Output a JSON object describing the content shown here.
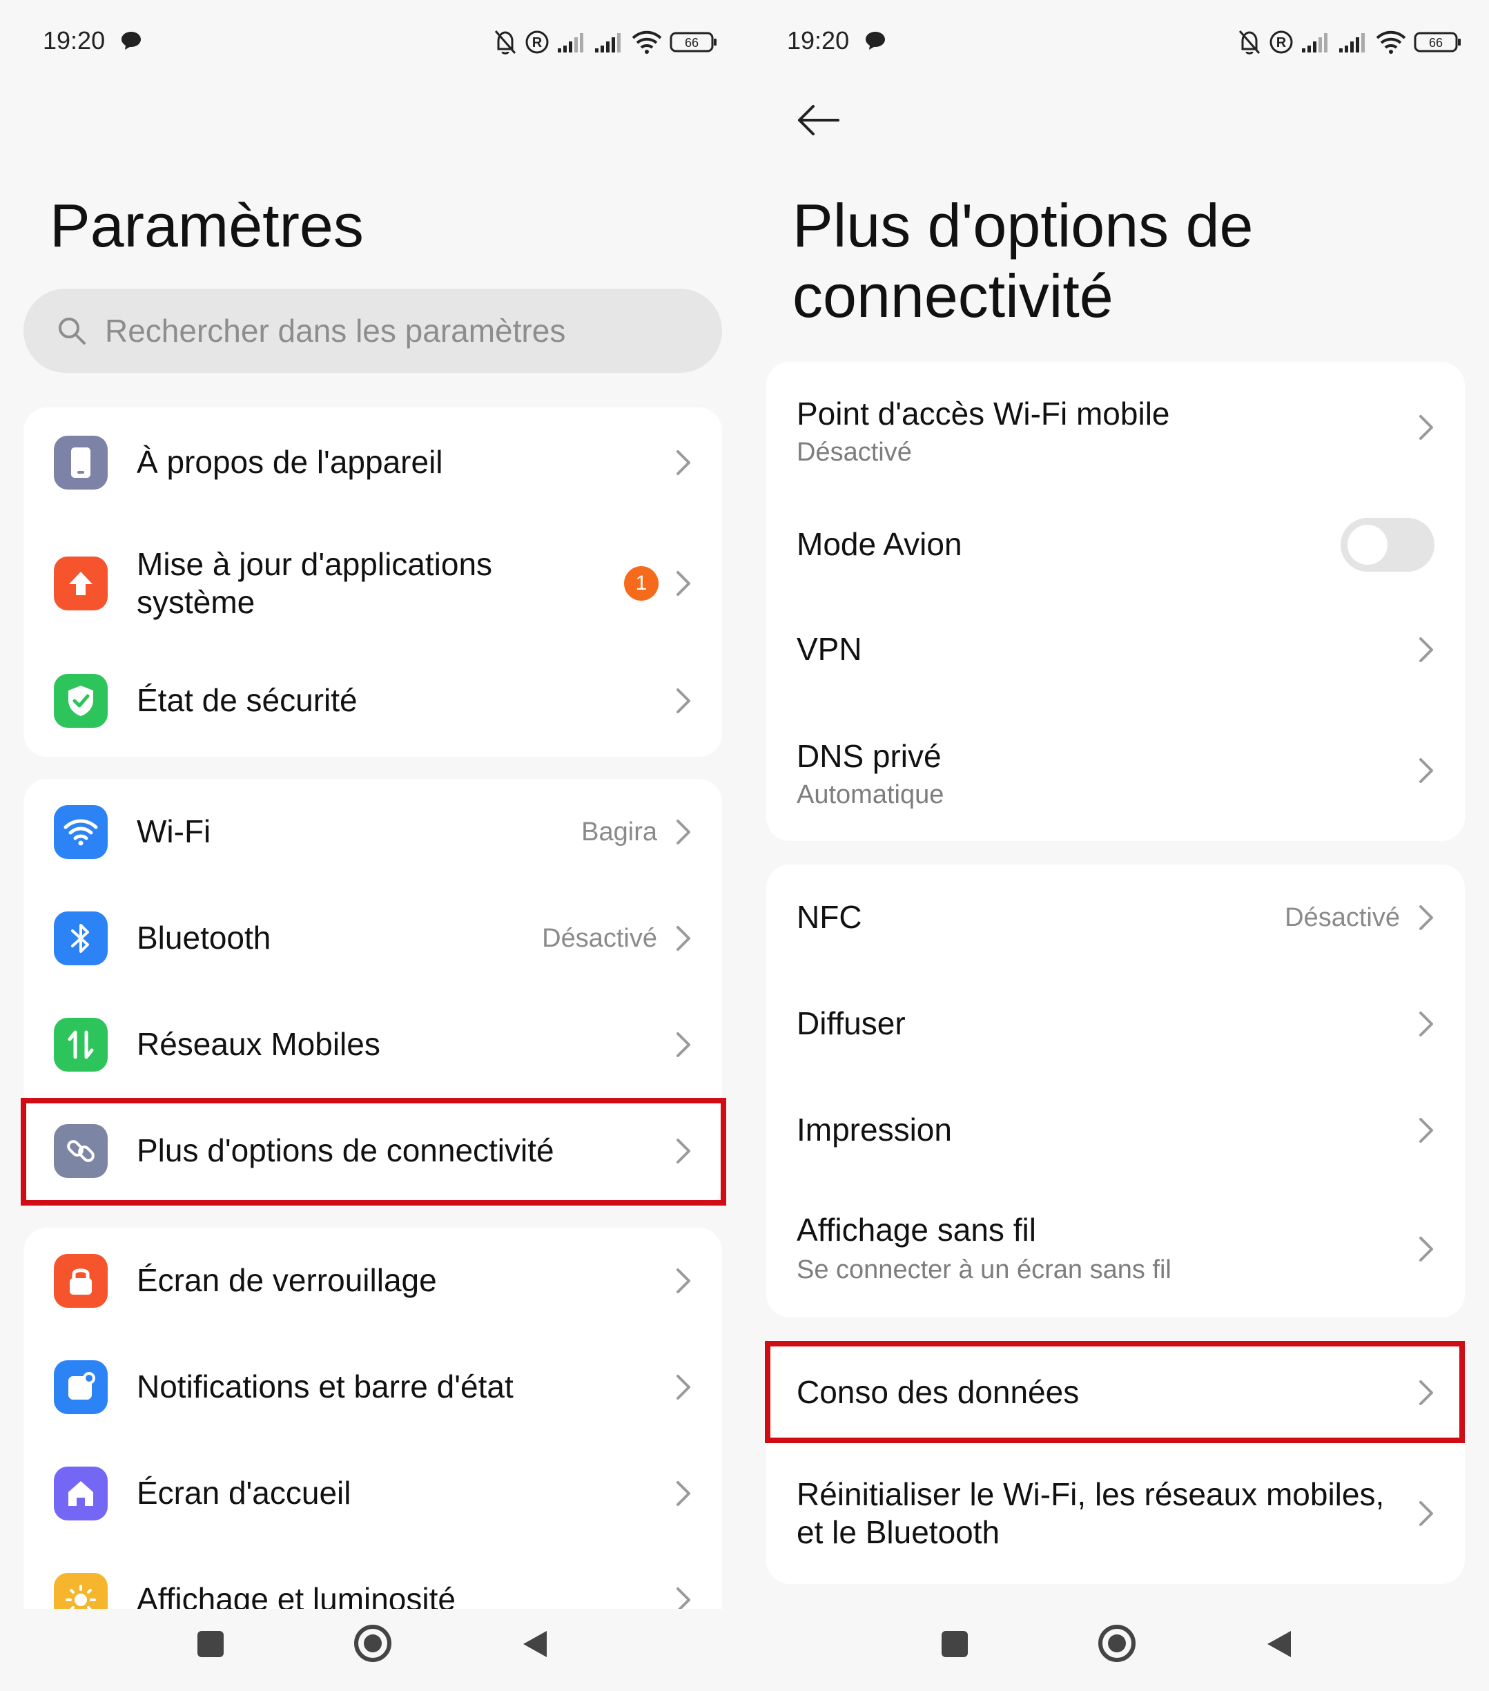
{
  "colors": {
    "accent_red": "#d00d14",
    "badge_orange": "#f66a1b",
    "about_icon": "#7c83a6",
    "update_icon": "#f5542c",
    "security_icon": "#2ec45c",
    "wifi_icon": "#2c83f5",
    "bluetooth_icon": "#2c83f5",
    "mobile_icon": "#2ec45c",
    "connectivity_icon": "#7d85a4",
    "lock_icon": "#f5542c",
    "notif_icon": "#2c83f5",
    "home_icon": "#7567f5",
    "display_icon": "#f5b52c"
  },
  "left": {
    "status": {
      "time": "19:20",
      "battery": "66"
    },
    "title": "Paramètres",
    "search": {
      "placeholder": "Rechercher dans les paramètres",
      "icon": "search-icon"
    },
    "group1": [
      {
        "label": "À propos de l'appareil",
        "icon": "phone-icon"
      },
      {
        "label_line1": "Mise à jour d'applications",
        "label_line2": "système",
        "badge": "1",
        "icon": "upload-arrow-icon"
      },
      {
        "label": "État de sécurité",
        "icon": "shield-check-icon"
      }
    ],
    "group2": [
      {
        "label": "Wi-Fi",
        "value": "Bagira",
        "icon": "wifi-icon"
      },
      {
        "label": "Bluetooth",
        "value": "Désactivé",
        "icon": "bluetooth-icon"
      },
      {
        "label": "Réseaux Mobiles",
        "icon": "mobile-data-icon"
      },
      {
        "label": "Plus d'options de connectivité",
        "icon": "link-icon"
      }
    ],
    "group3": [
      {
        "label": "Écran de verrouillage",
        "icon": "lock-icon"
      },
      {
        "label": "Notifications et barre d'état",
        "icon": "notification-icon"
      },
      {
        "label": "Écran d'accueil",
        "icon": "home-icon"
      },
      {
        "label": "Affichage et luminosité",
        "icon": "sun-icon"
      }
    ]
  },
  "right": {
    "status": {
      "time": "19:20",
      "battery": "66"
    },
    "title_line1": "Plus d'options de",
    "title_line2": "connectivité",
    "group1": [
      {
        "label": "Point d'accès Wi-Fi mobile",
        "sub": "Désactivé"
      },
      {
        "label": "Mode Avion",
        "toggle": false
      },
      {
        "label": "VPN"
      },
      {
        "label": "DNS privé",
        "sub": "Automatique"
      }
    ],
    "group2": [
      {
        "label": "NFC",
        "value": "Désactivé"
      },
      {
        "label": "Diffuser"
      },
      {
        "label": "Impression"
      },
      {
        "label": "Affichage sans fil",
        "sub": "Se connecter à un écran sans fil"
      }
    ],
    "group3": [
      {
        "label": "Conso des données"
      },
      {
        "label_line1": "Réinitialiser le Wi-Fi, les réseaux mobiles,",
        "label_line2": "et le Bluetooth"
      }
    ]
  }
}
